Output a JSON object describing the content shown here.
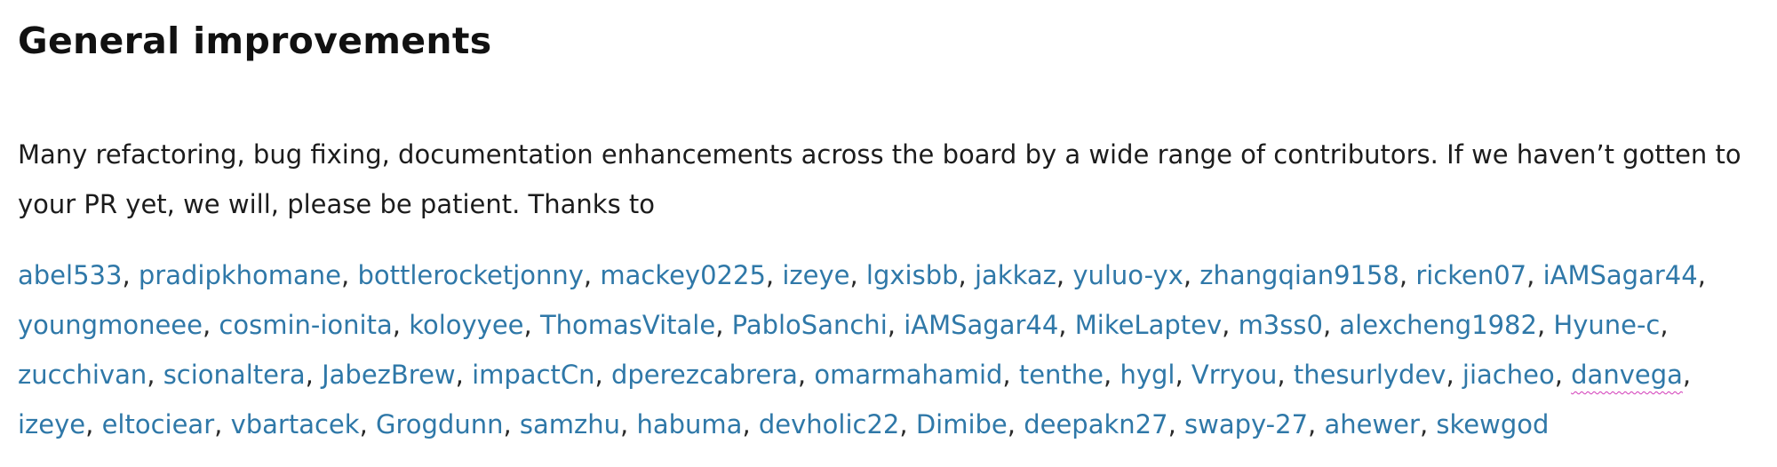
{
  "section": {
    "title": "General improvements",
    "intro": "Many refactoring, bug fixing, documentation enhancements across the board by a wide range of contributors. If we haven’t gotten to your PR yet, we will, please be patient. Thanks to"
  },
  "contributors": [
    "abel533",
    "pradipkhomane",
    "bottlerocketjonny",
    "mackey0225",
    "izeye",
    "lgxisbb",
    "jakkaz",
    "yuluo-yx",
    "zhangqian9158",
    "ricken07",
    "iAMSagar44",
    "youngmoneee",
    "cosmin-ionita",
    "koloyyee",
    "ThomasVitale",
    "PabloSanchi",
    "iAMSagar44",
    "MikeLaptev",
    "m3ss0",
    "alexcheng1982",
    "Hyune-c",
    "zucchivan",
    "scionaltera",
    "JabezBrew",
    "impactCn",
    "dperezcabrera",
    "omarmahamid",
    "tenthe",
    "hygl",
    "Vrryou",
    "thesurlydev",
    "jiacheo",
    "danvega",
    "izeye",
    "eltociear",
    "vbartacek",
    "Grogdunn",
    "samzhu",
    "habuma",
    "devholic22",
    "Dimibe",
    "deepakn27",
    "swapy-27",
    "ahewer",
    "skewgod"
  ],
  "spellcheck_flagged": [
    "danvega"
  ],
  "colors": {
    "link": "#2f78a8",
    "text": "#1c1c1c",
    "spellcheck_underline": "#d23ab8"
  }
}
